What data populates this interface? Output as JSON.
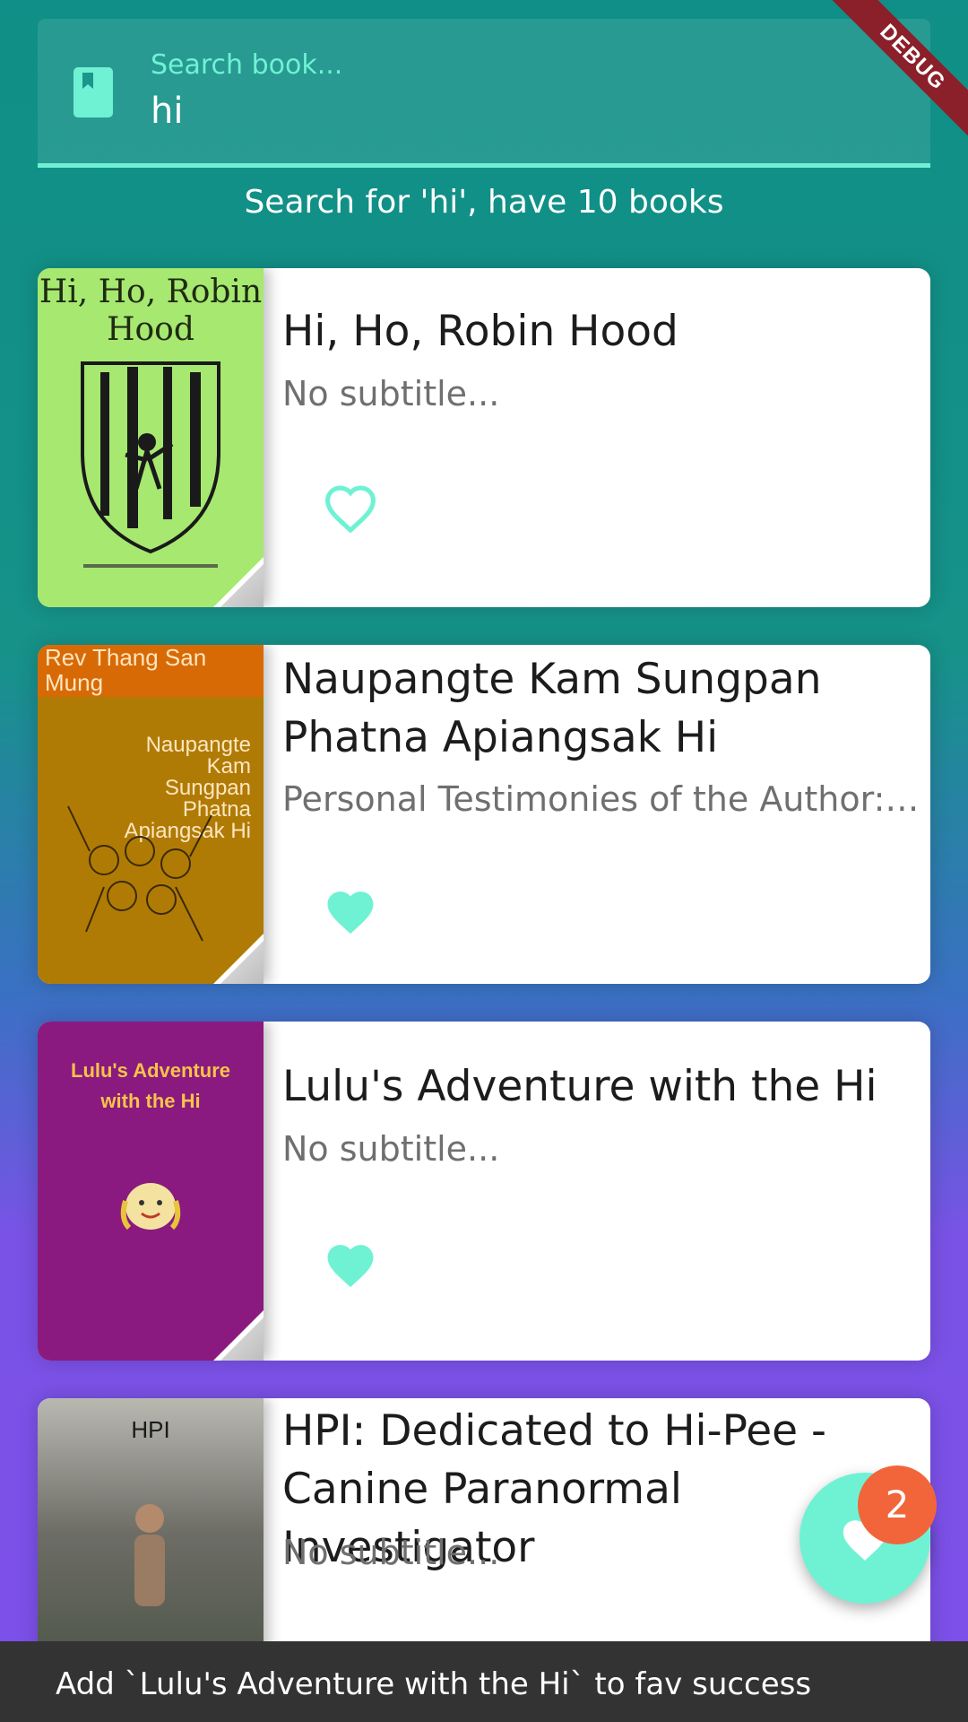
{
  "search": {
    "placeholder": "Search book...",
    "value": "hi",
    "result_text": "Search for 'hi', have 10 books"
  },
  "debug_banner": "DEBUG",
  "books": [
    {
      "title": "Hi, Ho, Robin Hood",
      "subtitle": "No subtitle...",
      "favorite": false,
      "cover": {
        "bg": "#a6e870",
        "text": "Hi, Ho, Robin Hood"
      }
    },
    {
      "title": "Naupangte Kam Sungpan Phatna Apiangsak Hi",
      "subtitle": "Personal Testimonies of the Author: ...",
      "favorite": true,
      "cover": {
        "bg": "#b07b05",
        "top_text": "Rev Thang San Mung",
        "text": "Naupangte Kam Sungpan Phatna Apiangsak Hi"
      }
    },
    {
      "title": "Lulu's Adventure with the Hi",
      "subtitle": "No subtitle...",
      "favorite": true,
      "cover": {
        "bg": "#8a1a7f",
        "text": "Lulu's Adventure with the Hi"
      }
    },
    {
      "title": "HPI: Dedicated to Hi-Pee - Canine Paranormal Investigator",
      "subtitle": "No subtitle...",
      "favorite": false,
      "cover": {
        "bg": "#6d6d66",
        "text": "HPI"
      }
    }
  ],
  "fab": {
    "badge_count": "2"
  },
  "snackbar": {
    "message": "Add `Lulu's Adventure with the Hi` to fav success"
  },
  "colors": {
    "accent": "#6ff2d4",
    "badge": "#f2653a",
    "snackbar": "#333333"
  }
}
